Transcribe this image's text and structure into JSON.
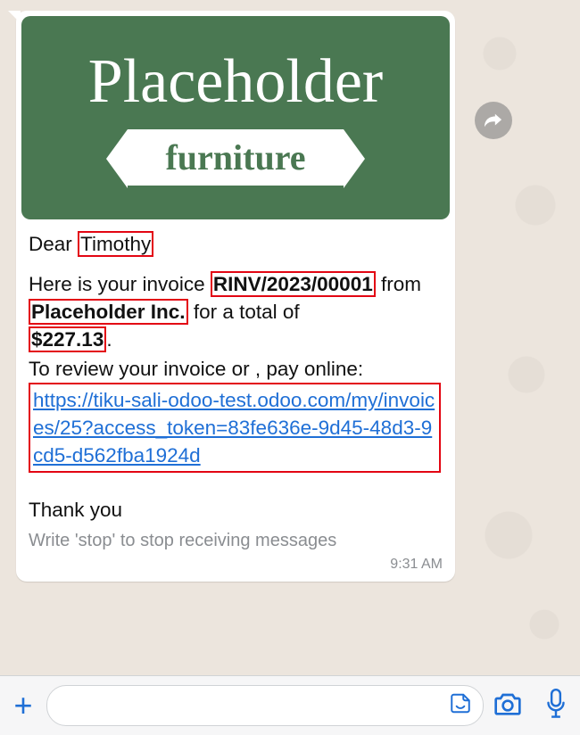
{
  "logo": {
    "top": "Placeholder",
    "ribbon": "furniture"
  },
  "message": {
    "greeting_prefix": "Dear ",
    "recipient": "Timothy",
    "line2_a": "Here is your invoice ",
    "invoice_no": "RINV/2023/00001",
    "line2_b": " from ",
    "company": "Placeholder Inc.",
    "line2_c": " for a total of ",
    "amount": "$227.13",
    "line2_d": ".",
    "review_lead": "To review your invoice or , pay online:",
    "url": "https://tiku-sali-odoo-test.odoo.com/my/invoices/25?access_token=83fe636e-9d45-48d3-9cd5-d562fba1924d",
    "thanks": "Thank you",
    "opt_out": "Write 'stop' to stop receiving messages",
    "time": "9:31 AM"
  }
}
